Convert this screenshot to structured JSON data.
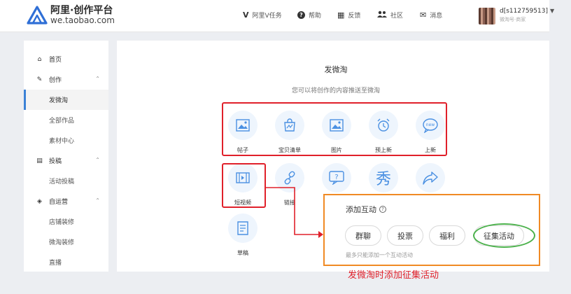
{
  "header": {
    "logo_title": "阿里·创作平台",
    "logo_url": "we.taobao.com",
    "nav": [
      {
        "icon": "V",
        "icon_name": "v-task-icon",
        "label": "阿里V任务"
      },
      {
        "icon": "?",
        "icon_name": "help-icon",
        "label": "帮助"
      },
      {
        "icon": "▦",
        "icon_name": "feedback-icon",
        "label": "反馈"
      },
      {
        "icon": "👥",
        "icon_name": "community-icon",
        "label": "社区"
      },
      {
        "icon": "✉",
        "icon_name": "message-icon",
        "label": "消息"
      }
    ],
    "user_name": "d[s112759513]",
    "user_sub": "微淘号·商家"
  },
  "sidebar": {
    "items": [
      {
        "label": "首页",
        "kind": "top",
        "icon": "⌂",
        "icon_name": "home-icon"
      },
      {
        "label": "创作",
        "kind": "top",
        "icon": "✎",
        "icon_name": "pen-icon",
        "expanded": true
      },
      {
        "label": "发微淘",
        "kind": "sub",
        "active": true
      },
      {
        "label": "全部作品",
        "kind": "sub"
      },
      {
        "label": "素材中心",
        "kind": "sub"
      },
      {
        "label": "投稿",
        "kind": "top",
        "icon": "▤",
        "icon_name": "document-icon",
        "expanded": true
      },
      {
        "label": "活动投稿",
        "kind": "sub"
      },
      {
        "label": "自运营",
        "kind": "top",
        "icon": "◈",
        "icon_name": "box-icon",
        "expanded": true
      },
      {
        "label": "店铺装修",
        "kind": "sub"
      },
      {
        "label": "微淘装修",
        "kind": "sub"
      },
      {
        "label": "直播",
        "kind": "sub"
      }
    ]
  },
  "main": {
    "title": "发微淘",
    "subtitle": "您可以将创作的内容推送至微淘",
    "tiles": [
      {
        "label": "帖子",
        "icon_name": "post-icon"
      },
      {
        "label": "宝贝清单",
        "icon_name": "shopping-bag-icon"
      },
      {
        "label": "图片",
        "icon_name": "image-icon"
      },
      {
        "label": "预上新",
        "icon_name": "alarm-clock-icon"
      },
      {
        "label": "上新",
        "icon_name": "new-bubble-icon"
      },
      {
        "label": "短视频",
        "icon_name": "video-icon"
      },
      {
        "label": "链接",
        "icon_name": "link-icon"
      },
      {
        "label": "",
        "icon_name": "question-chat-icon"
      },
      {
        "label": "",
        "icon_name": "show-icon"
      },
      {
        "label": "",
        "icon_name": "share-arrow-icon"
      },
      {
        "label": "草稿",
        "icon_name": "draft-icon"
      }
    ]
  },
  "interaction": {
    "title": "添加互动",
    "buttons": [
      "群聊",
      "投票",
      "福利",
      "征集活动"
    ],
    "note": "最多只能添加一个互动活动"
  },
  "annotation": {
    "caption": "发微淘时添加征集活动"
  },
  "colors": {
    "accent_blue": "#3b82d6",
    "icon_bg": "#eef5fd",
    "highlight_red": "#e0202a",
    "highlight_orange": "#f08a24",
    "highlight_green": "#4bb14b"
  }
}
